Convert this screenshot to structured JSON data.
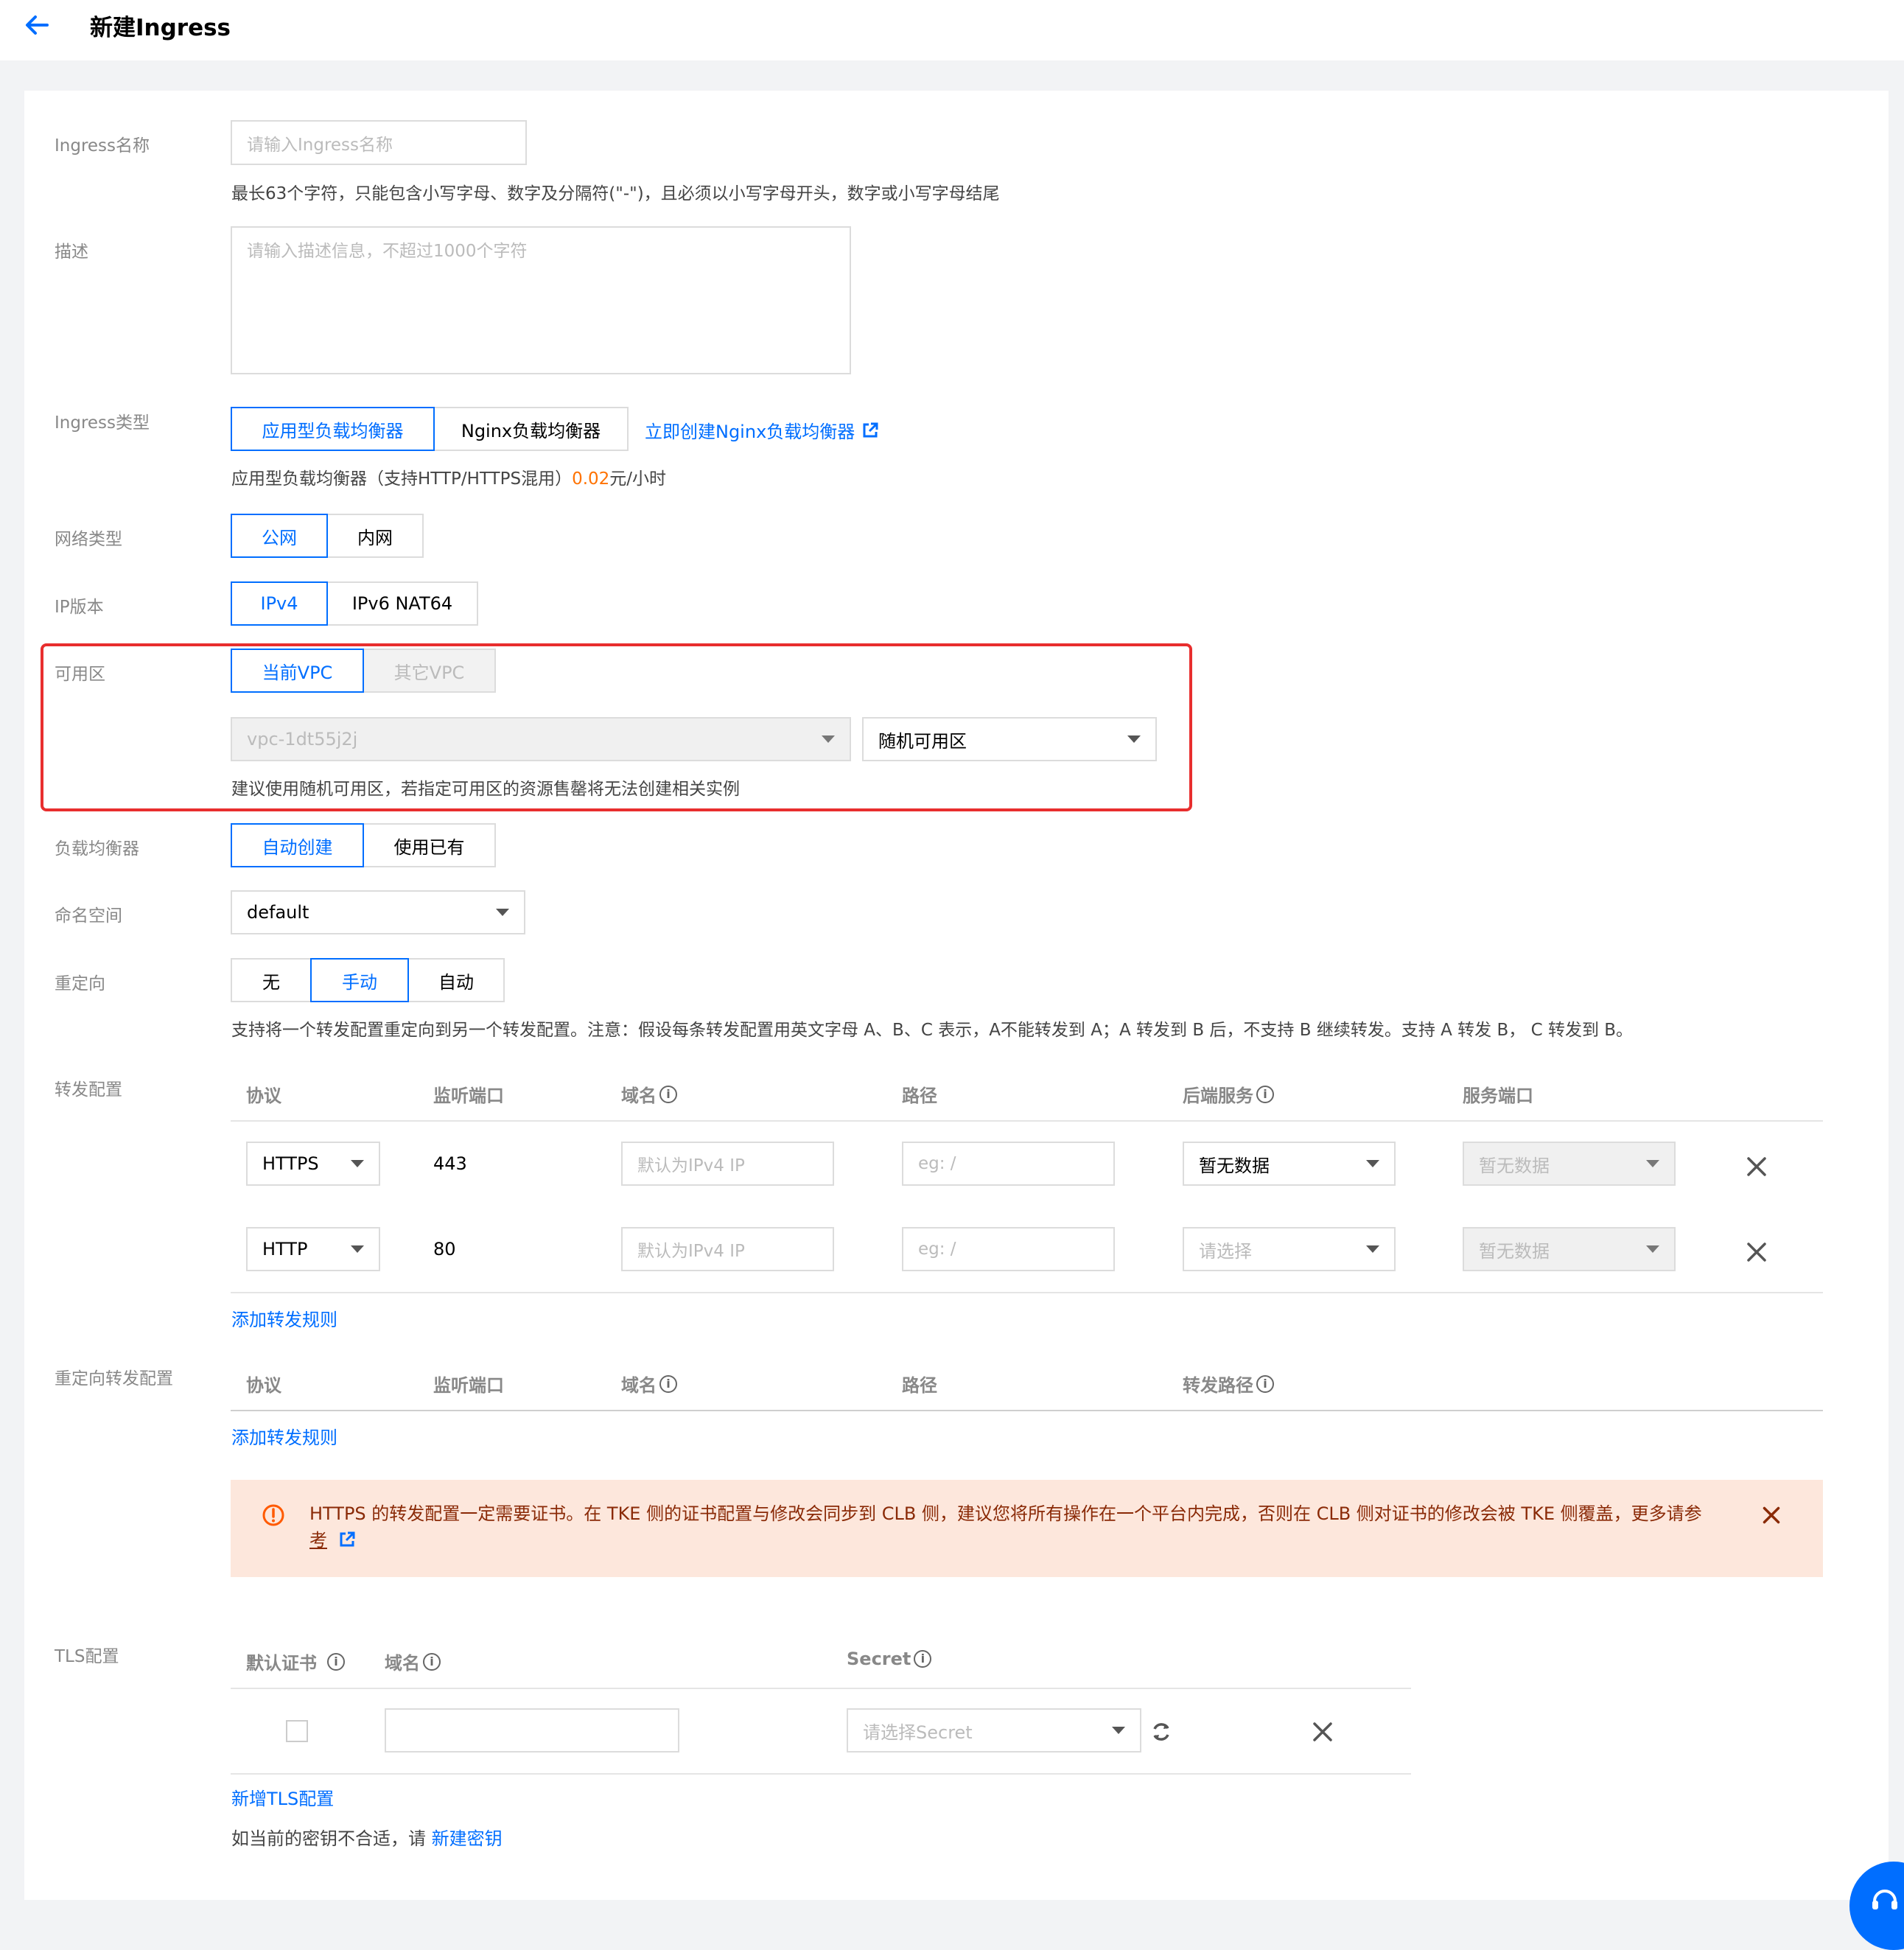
{
  "header": {
    "title": "新建Ingress"
  },
  "form": {
    "name": {
      "label": "Ingress名称",
      "placeholder": "请输入Ingress名称",
      "hint": "最长63个字符，只能包含小写字母、数字及分隔符(\"-\")，且必须以小写字母开头，数字或小写字母结尾"
    },
    "desc": {
      "label": "描述",
      "placeholder": "请输入描述信息，不超过1000个字符"
    },
    "ingress_type": {
      "label": "Ingress类型",
      "options": [
        "应用型负载均衡器",
        "Nginx负载均衡器"
      ],
      "selected": "应用型负载均衡器",
      "create_link": "立即创建Nginx负载均衡器",
      "hint_prefix": "应用型负载均衡器（支持HTTP/HTTPS混用）",
      "hint_price": "0.02",
      "hint_suffix": "元/小时"
    },
    "network": {
      "label": "网络类型",
      "options": [
        "公网",
        "内网"
      ],
      "selected": "公网"
    },
    "ip_version": {
      "label": "IP版本",
      "options": [
        "IPv4",
        "IPv6 NAT64"
      ],
      "selected": "IPv4"
    },
    "zone": {
      "label": "可用区",
      "options": [
        "当前VPC",
        "其它VPC"
      ],
      "selected": "当前VPC",
      "vpc_value": "vpc-1dt55j2j",
      "zone_value": "随机可用区",
      "hint": "建议使用随机可用区，若指定可用区的资源售罄将无法创建相关实例"
    },
    "lb": {
      "label": "负载均衡器",
      "options": [
        "自动创建",
        "使用已有"
      ],
      "selected": "自动创建"
    },
    "namespace": {
      "label": "命名空间",
      "value": "default"
    },
    "redirect": {
      "label": "重定向",
      "options": [
        "无",
        "手动",
        "自动"
      ],
      "selected": "手动",
      "hint": "支持将一个转发配置重定向到另一个转发配置。注意：假设每条转发配置用英文字母 A、B、C 表示，A不能转发到 A；A 转发到 B 后，不支持 B 继续转发。支持 A 转发 B， C 转发到 B。"
    },
    "forward": {
      "label": "转发配置",
      "columns": [
        "协议",
        "监听端口",
        "域名",
        "路径",
        "后端服务",
        "服务端口"
      ],
      "rows": [
        {
          "protocol": "HTTPS",
          "port": "443",
          "domain_placeholder": "默认为IPv4 IP",
          "path_placeholder": "eg: /",
          "backend": "暂无数据",
          "service_port": "暂无数据"
        },
        {
          "protocol": "HTTP",
          "port": "80",
          "domain_placeholder": "默认为IPv4 IP",
          "path_placeholder": "eg: /",
          "backend": "请选择",
          "service_port": "暂无数据"
        }
      ],
      "add_link": "添加转发规则"
    },
    "redirect_forward": {
      "label": "重定向转发配置",
      "columns": [
        "协议",
        "监听端口",
        "域名",
        "路径",
        "转发路径"
      ],
      "add_link": "添加转发规则"
    },
    "alert": {
      "text": "HTTPS 的转发配置一定需要证书。在 TKE 侧的证书配置与修改会同步到 CLB 侧，建议您将所有操作在一个平台内完成，否则在 CLB 侧对证书的修改会被 TKE 侧覆盖，更多请参",
      "link": "考"
    },
    "tls": {
      "label": "TLS配置",
      "columns": [
        "默认证书",
        "域名",
        "Secret"
      ],
      "secret_placeholder": "请选择Secret",
      "add_link": "新增TLS配置",
      "footer_text": "如当前的密钥不合适，请",
      "footer_link": "新建密钥"
    }
  },
  "colors": {
    "accent": "#006eff",
    "highlight": "#e82e2e",
    "price": "#ff7200",
    "alert_bg": "#fde7dc",
    "alert_text": "#8a2a07"
  }
}
